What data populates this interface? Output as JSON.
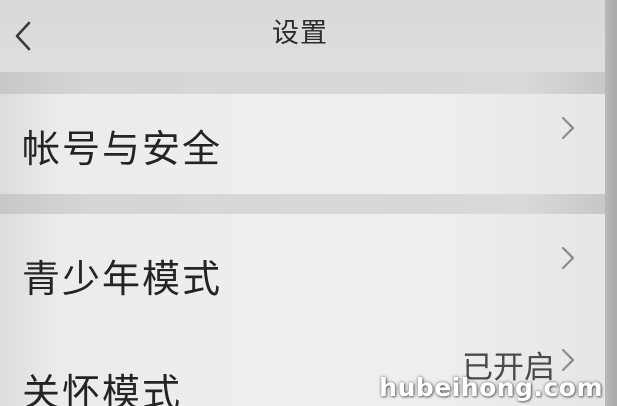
{
  "header": {
    "title": "设置",
    "back_icon": "chevron-left-icon"
  },
  "settings": {
    "items": [
      {
        "label": "帐号与安全",
        "value": "",
        "icon": "chevron-right-icon"
      },
      {
        "label": "青少年模式",
        "value": "",
        "icon": "chevron-right-icon"
      },
      {
        "label": "关怀模式",
        "value": "已开启",
        "icon": "chevron-right-icon"
      }
    ]
  },
  "watermark": {
    "text": "hubeihong.com"
  },
  "colors": {
    "header_bg": "#dedede",
    "row_bg": "#ececec",
    "text": "#242424",
    "chevron": "#8a8a8a"
  }
}
